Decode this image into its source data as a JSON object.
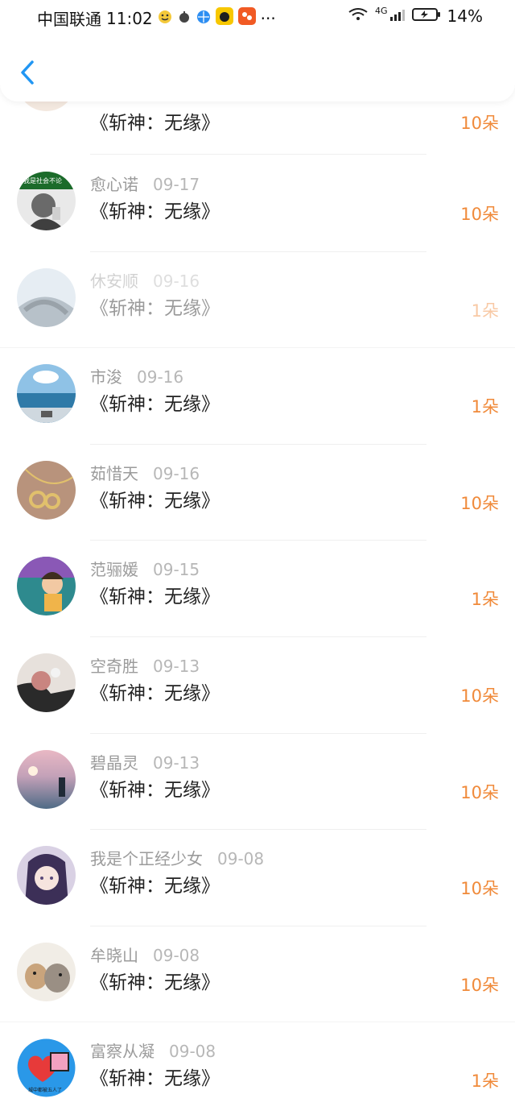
{
  "status": {
    "carrier": "中国联通",
    "time": "11:02",
    "dots": "···",
    "network": "4G",
    "battery": "14%"
  },
  "rows": [
    {
      "name": "",
      "date": "",
      "title": "《斩神：无缘》",
      "amount": "10朵"
    },
    {
      "name": "愈心诺",
      "date": "09-17",
      "title": "《斩神：无缘》",
      "amount": "10朵"
    },
    {
      "name": "休安顺",
      "date": "09-16",
      "title": "《斩神：无缘》",
      "amount": "1朵"
    },
    {
      "name": "市浚",
      "date": "09-16",
      "title": "《斩神：无缘》",
      "amount": "1朵"
    },
    {
      "name": "茹惜天",
      "date": "09-16",
      "title": "《斩神：无缘》",
      "amount": "10朵"
    },
    {
      "name": "范骊媛",
      "date": "09-15",
      "title": "《斩神：无缘》",
      "amount": "1朵"
    },
    {
      "name": "空奇胜",
      "date": "09-13",
      "title": "《斩神：无缘》",
      "amount": "10朵"
    },
    {
      "name": "碧晶灵",
      "date": "09-13",
      "title": "《斩神：无缘》",
      "amount": "10朵"
    },
    {
      "name": "我是个正经少女",
      "date": "09-08",
      "title": "《斩神：无缘》",
      "amount": "10朵"
    },
    {
      "name": "牟晓山",
      "date": "09-08",
      "title": "《斩神：无缘》",
      "amount": "10朵"
    },
    {
      "name": "富察从凝",
      "date": "09-08",
      "title": "《斩神：无缘》",
      "amount": "1朵"
    }
  ],
  "avatar_text": {
    "row1": "我是社会不论",
    "row10": "城中都被五人了"
  },
  "colors": {
    "accent": "#f08a3a",
    "back": "#2196f3"
  }
}
